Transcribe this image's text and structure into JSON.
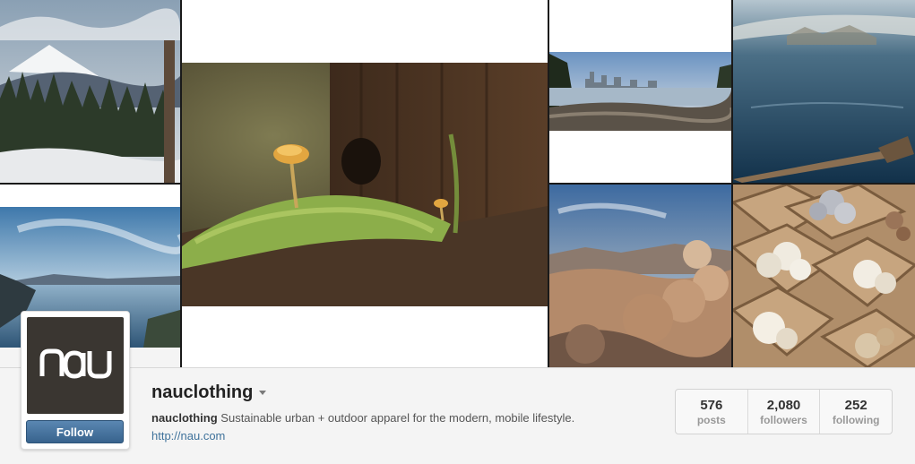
{
  "profile": {
    "username": "nauclothing",
    "avatar_logo_text": "nau",
    "follow_label": "Follow",
    "bio_name": "nauclothing",
    "bio_text": "Sustainable urban + outdoor apparel for the modern, mobile lifestyle.",
    "website": "http://nau.com"
  },
  "stats": [
    {
      "value": "576",
      "label": "posts"
    },
    {
      "value": "2,080",
      "label": "followers"
    },
    {
      "value": "252",
      "label": "following"
    }
  ],
  "colors": {
    "follow_button": "#4a76a2",
    "link": "#3f729b",
    "avatar_bg": "#3a3631"
  },
  "mosaic_photos": [
    {
      "name": "mountain-forest-photo"
    },
    {
      "name": "lake-mountains-photo"
    },
    {
      "name": "mushroom-moss-photo"
    },
    {
      "name": "city-skyline-shore-photo"
    },
    {
      "name": "lake-paddle-photo"
    },
    {
      "name": "desert-boulders-photo"
    },
    {
      "name": "mushroom-crates-photo"
    }
  ]
}
